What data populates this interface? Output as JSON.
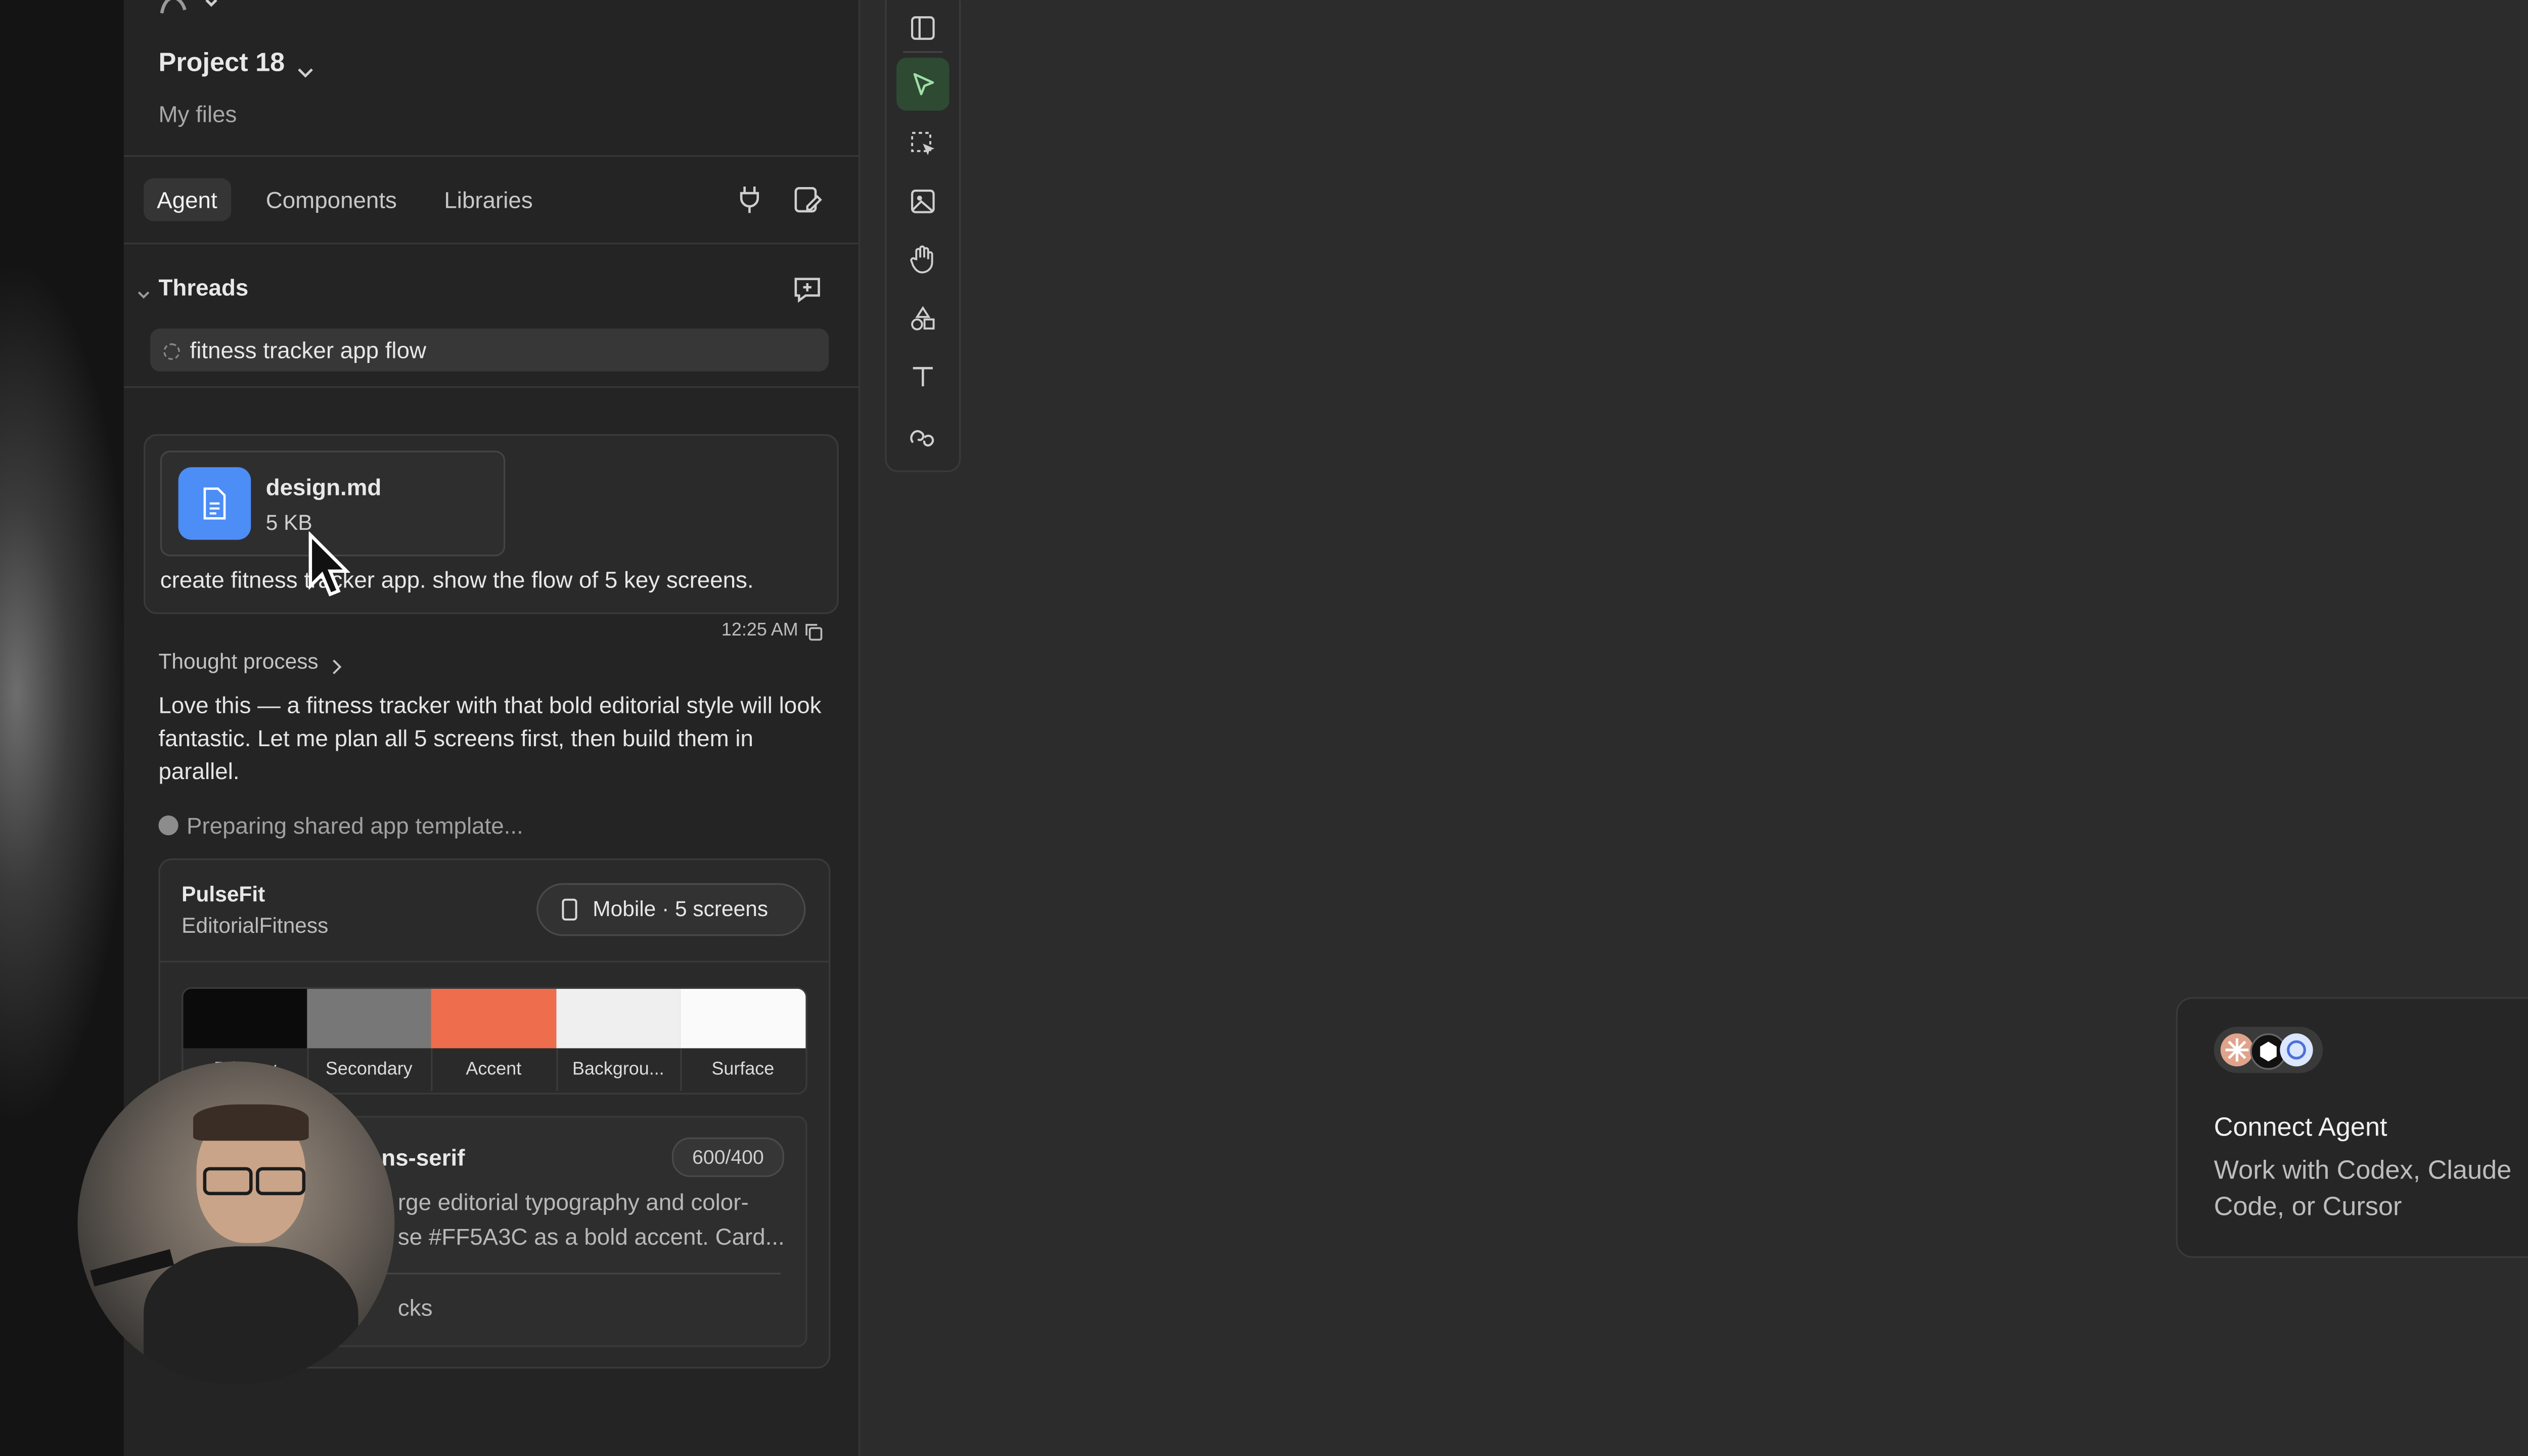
{
  "project": {
    "name": "Project 18",
    "subtitle": "My files"
  },
  "tabs": [
    {
      "label": "Agent",
      "active": true
    },
    {
      "label": "Components",
      "active": false
    },
    {
      "label": "Libraries",
      "active": false
    }
  ],
  "threads": {
    "header": "Threads",
    "items": [
      {
        "title": "fitness tracker app flow"
      }
    ]
  },
  "message": {
    "attachment": {
      "name": "design.md",
      "size": "5 KB",
      "icon": "document-icon"
    },
    "text": "create fitness tracker app. show the flow of 5 key screens.",
    "time": "12:25 AM"
  },
  "response": {
    "thought_label": "Thought process",
    "text": "Love this — a fitness tracker with that bold editorial style will look fantastic. Let me plan all 5 screens first, then build them in parallel.",
    "status": "Preparing shared app template..."
  },
  "design_card": {
    "title": "PulseFit",
    "subtitle": "EditorialFitness",
    "badge": "Mobile · 5 screens",
    "palette": [
      {
        "label": "Primary",
        "color": "#0b0b0b"
      },
      {
        "label": "Secondary",
        "color": "#777777"
      },
      {
        "label": "Accent",
        "color": "#ee6d4d"
      },
      {
        "label": "Backgrou...",
        "color": "#efefef"
      },
      {
        "label": "Surface",
        "color": "#fafafa"
      }
    ],
    "typography": {
      "label": "ns-serif",
      "weights": "600/400",
      "desc_line1": "rge editorial typography and color-",
      "desc_line2": "se #FF5A3C as a bold accent. Card...",
      "footer": "cks"
    }
  },
  "toolbar": {
    "tools": [
      "sidebar-icon",
      "pointer-icon",
      "select-icon",
      "image-icon",
      "hand-icon",
      "shapes-icon",
      "text-icon",
      "link-icon"
    ],
    "active": "pointer-icon"
  },
  "connect": {
    "title": "Connect Agent",
    "desc_line1": "Work with Codex, Claude",
    "desc_line2": "Code, or Cursor"
  },
  "colors": {
    "accent_green": "#2f4a33",
    "panel": "#242424",
    "canvas": "#2c2c2c",
    "file_blue": "#4c8df6"
  }
}
